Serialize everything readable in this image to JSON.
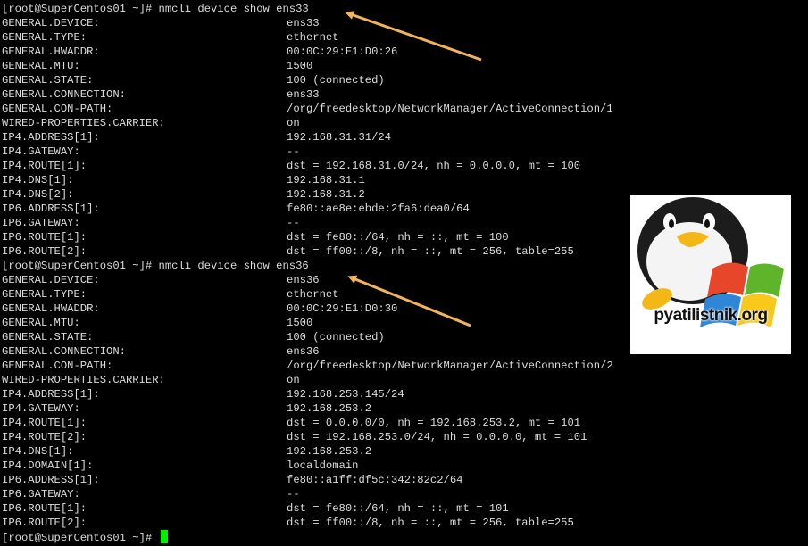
{
  "terminal": {
    "bg_color": "#000000",
    "text_color": "#dcdcdc",
    "cursor_color": "#00ee00",
    "lines": [
      {
        "type": "prompt",
        "text": "[root@SuperCentos01 ~]# nmcli device show ens33"
      },
      {
        "type": "kv",
        "key": "GENERAL.DEVICE:",
        "value": "ens33"
      },
      {
        "type": "kv",
        "key": "GENERAL.TYPE:",
        "value": "ethernet"
      },
      {
        "type": "kv",
        "key": "GENERAL.HWADDR:",
        "value": "00:0C:29:E1:D0:26"
      },
      {
        "type": "kv",
        "key": "GENERAL.MTU:",
        "value": "1500"
      },
      {
        "type": "kv",
        "key": "GENERAL.STATE:",
        "value": "100 (connected)"
      },
      {
        "type": "kv",
        "key": "GENERAL.CONNECTION:",
        "value": "ens33"
      },
      {
        "type": "kv",
        "key": "GENERAL.CON-PATH:",
        "value": "/org/freedesktop/NetworkManager/ActiveConnection/1"
      },
      {
        "type": "kv",
        "key": "WIRED-PROPERTIES.CARRIER:",
        "value": "on"
      },
      {
        "type": "kv",
        "key": "IP4.ADDRESS[1]:",
        "value": "192.168.31.31/24"
      },
      {
        "type": "kv",
        "key": "IP4.GATEWAY:",
        "value": "--"
      },
      {
        "type": "kv",
        "key": "IP4.ROUTE[1]:",
        "value": "dst = 192.168.31.0/24, nh = 0.0.0.0, mt = 100"
      },
      {
        "type": "kv",
        "key": "IP4.DNS[1]:",
        "value": "192.168.31.1"
      },
      {
        "type": "kv",
        "key": "IP4.DNS[2]:",
        "value": "192.168.31.2"
      },
      {
        "type": "kv",
        "key": "IP6.ADDRESS[1]:",
        "value": "fe80::ae8e:ebde:2fa6:dea0/64"
      },
      {
        "type": "kv",
        "key": "IP6.GATEWAY:",
        "value": "--"
      },
      {
        "type": "kv",
        "key": "IP6.ROUTE[1]:",
        "value": "dst = fe80::/64, nh = ::, mt = 100"
      },
      {
        "type": "kv",
        "key": "IP6.ROUTE[2]:",
        "value": "dst = ff00::/8, nh = ::, mt = 256, table=255"
      },
      {
        "type": "prompt",
        "text": "[root@SuperCentos01 ~]# nmcli device show ens36"
      },
      {
        "type": "kv",
        "key": "GENERAL.DEVICE:",
        "value": "ens36"
      },
      {
        "type": "kv",
        "key": "GENERAL.TYPE:",
        "value": "ethernet"
      },
      {
        "type": "kv",
        "key": "GENERAL.HWADDR:",
        "value": "00:0C:29:E1:D0:30"
      },
      {
        "type": "kv",
        "key": "GENERAL.MTU:",
        "value": "1500"
      },
      {
        "type": "kv",
        "key": "GENERAL.STATE:",
        "value": "100 (connected)"
      },
      {
        "type": "kv",
        "key": "GENERAL.CONNECTION:",
        "value": "ens36"
      },
      {
        "type": "kv",
        "key": "GENERAL.CON-PATH:",
        "value": "/org/freedesktop/NetworkManager/ActiveConnection/2"
      },
      {
        "type": "kv",
        "key": "WIRED-PROPERTIES.CARRIER:",
        "value": "on"
      },
      {
        "type": "kv",
        "key": "IP4.ADDRESS[1]:",
        "value": "192.168.253.145/24"
      },
      {
        "type": "kv",
        "key": "IP4.GATEWAY:",
        "value": "192.168.253.2"
      },
      {
        "type": "kv",
        "key": "IP4.ROUTE[1]:",
        "value": "dst = 0.0.0.0/0, nh = 192.168.253.2, mt = 101"
      },
      {
        "type": "kv",
        "key": "IP4.ROUTE[2]:",
        "value": "dst = 192.168.253.0/24, nh = 0.0.0.0, mt = 101"
      },
      {
        "type": "kv",
        "key": "IP4.DNS[1]:",
        "value": "192.168.253.2"
      },
      {
        "type": "kv",
        "key": "IP4.DOMAIN[1]:",
        "value": "localdomain"
      },
      {
        "type": "kv",
        "key": "IP6.ADDRESS[1]:",
        "value": "fe80::a1ff:df5c:342:82c2/64"
      },
      {
        "type": "kv",
        "key": "IP6.GATEWAY:",
        "value": "--"
      },
      {
        "type": "kv",
        "key": "IP6.ROUTE[1]:",
        "value": "dst = fe80::/64, nh = ::, mt = 101"
      },
      {
        "type": "kv",
        "key": "IP6.ROUTE[2]:",
        "value": "dst = ff00::/8, nh = ::, mt = 256, table=255"
      },
      {
        "type": "prompt_cursor",
        "text": "[root@SuperCentos01 ~]# "
      }
    ]
  },
  "annotations": {
    "arrow_color": "#f2b45a",
    "arrows": [
      {
        "points_to": "ens33-command"
      },
      {
        "points_to": "ens36-command"
      }
    ]
  },
  "watermark": {
    "site_text": "pyatilistnik.org",
    "icon": "penguin-windows-logo-icon"
  }
}
